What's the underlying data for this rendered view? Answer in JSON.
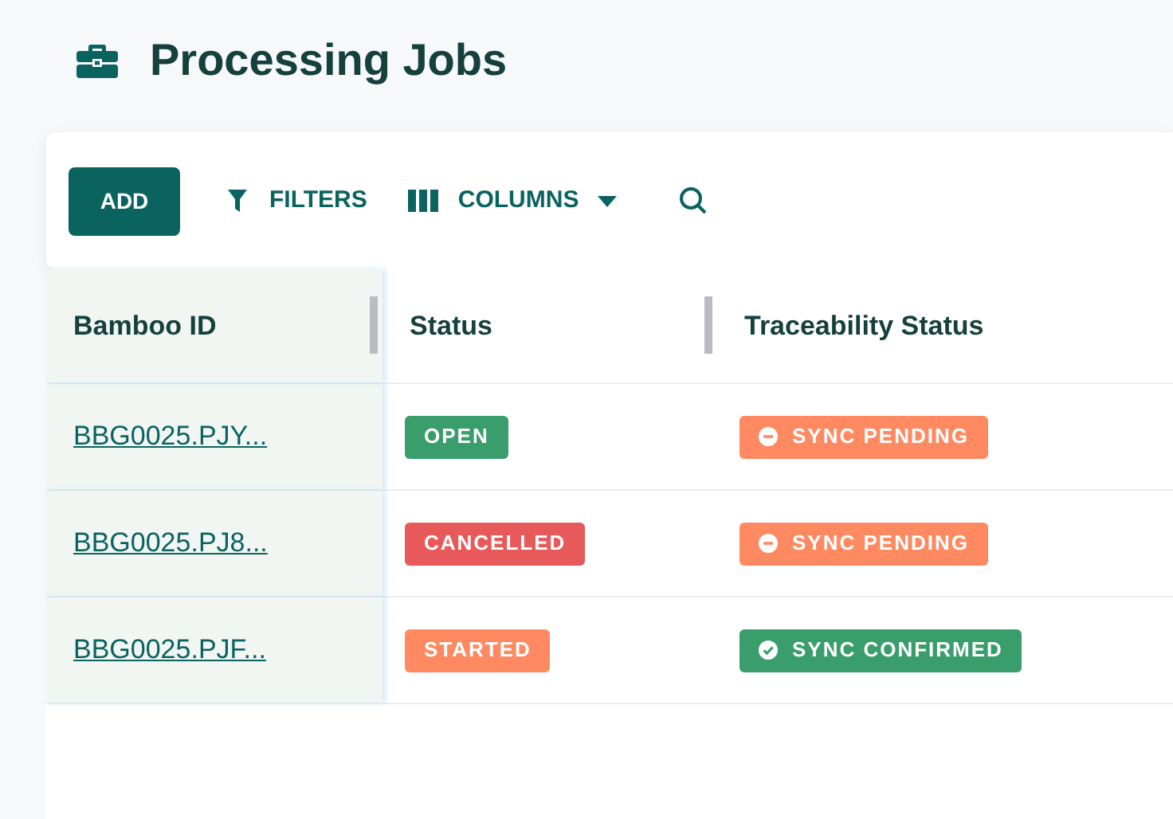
{
  "page": {
    "title": "Processing Jobs"
  },
  "toolbar": {
    "add_button": "ADD",
    "filters_button": "FILTERS",
    "columns_button": "COLUMNS"
  },
  "table": {
    "columns": [
      "Bamboo ID",
      "Status",
      "Traceability Status"
    ],
    "rows": [
      {
        "bamboo_id": "BBG0025.PJY...",
        "status": {
          "label": "OPEN",
          "color": "#3a9e6c"
        },
        "traceability": {
          "label": "SYNC PENDING",
          "kind": "pending",
          "color": "#ff8a62"
        }
      },
      {
        "bamboo_id": "BBG0025.PJ8...",
        "status": {
          "label": "CANCELLED",
          "color": "#e85a5a"
        },
        "traceability": {
          "label": "SYNC PENDING",
          "kind": "pending",
          "color": "#ff8a62"
        }
      },
      {
        "bamboo_id": "BBG0025.PJF...",
        "status": {
          "label": "STARTED",
          "color": "#ff8a62"
        },
        "traceability": {
          "label": "SYNC CONFIRMED",
          "kind": "confirmed",
          "color": "#3a9e6c"
        }
      }
    ]
  }
}
